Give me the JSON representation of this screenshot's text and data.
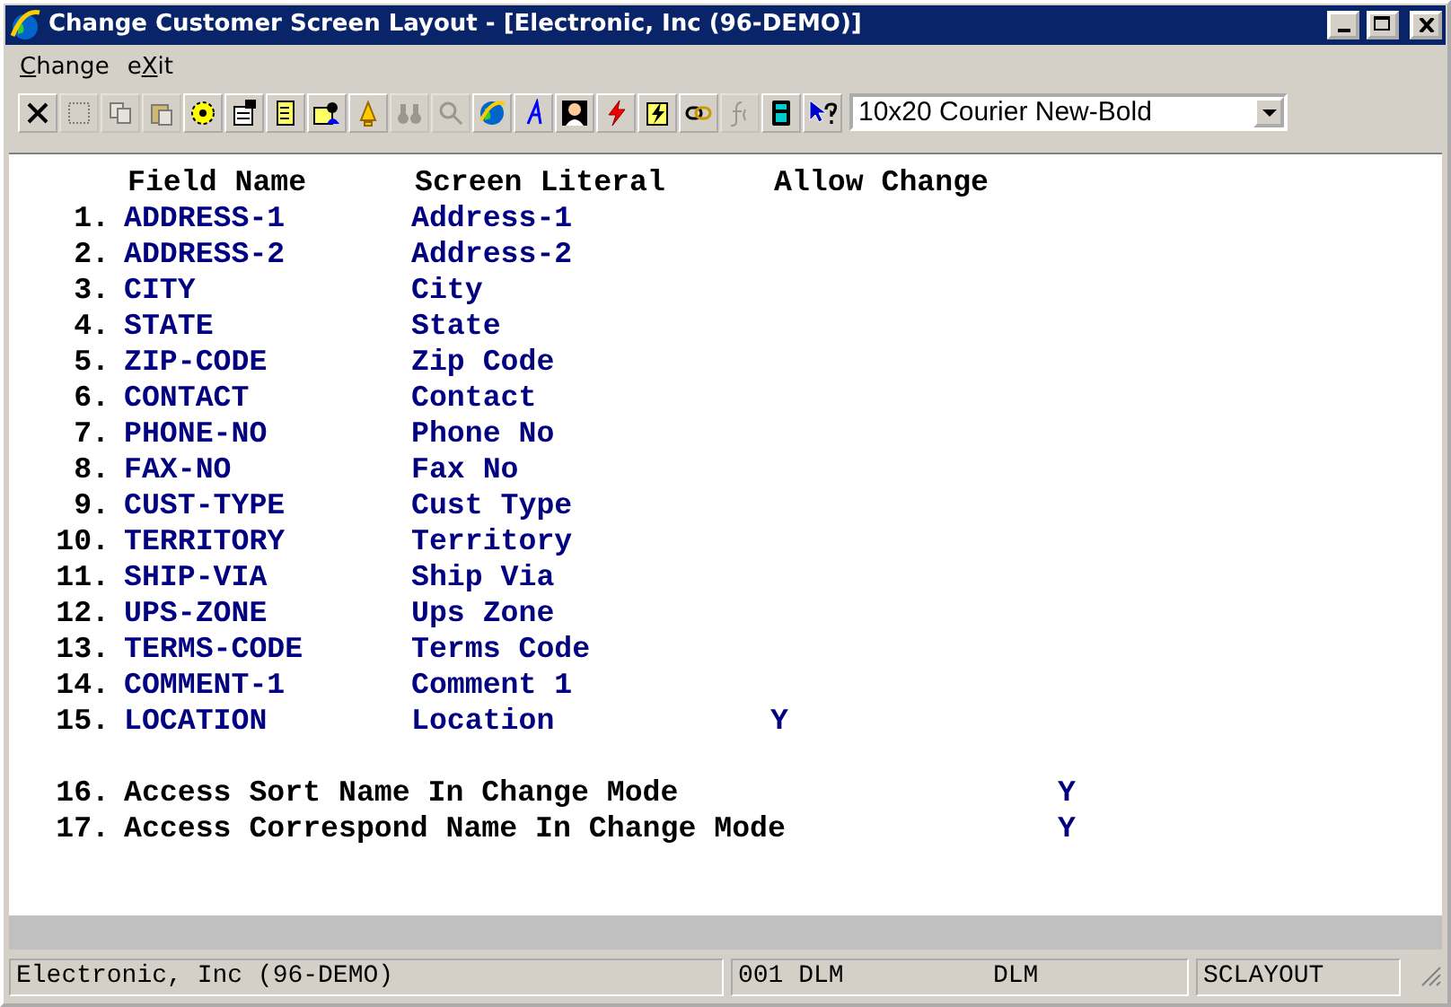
{
  "window": {
    "title": "Change Customer Screen Layout - [Electronic, Inc (96-DEMO)]"
  },
  "menu": [
    {
      "label": "Change"
    },
    {
      "label": "eXit"
    }
  ],
  "toolbar": [
    {
      "kind": "delete",
      "disabled": false
    },
    {
      "kind": "select",
      "disabled": true
    },
    {
      "kind": "copy",
      "disabled": true
    },
    {
      "kind": "paste",
      "disabled": true
    },
    {
      "kind": "gear",
      "disabled": false
    },
    {
      "kind": "properties",
      "disabled": false
    },
    {
      "kind": "document",
      "disabled": false
    },
    {
      "kind": "person-card",
      "disabled": false
    },
    {
      "kind": "bell",
      "disabled": false
    },
    {
      "kind": "binoculars",
      "disabled": true
    },
    {
      "kind": "magnifier",
      "disabled": true
    },
    {
      "kind": "globe",
      "disabled": false
    },
    {
      "kind": "script",
      "disabled": false
    },
    {
      "kind": "person",
      "disabled": false
    },
    {
      "kind": "lightning",
      "disabled": false
    },
    {
      "kind": "lightning-page",
      "disabled": false
    },
    {
      "kind": "link",
      "disabled": false
    },
    {
      "kind": "function",
      "disabled": true
    },
    {
      "kind": "calculator",
      "disabled": false
    },
    {
      "kind": "help-pointer",
      "disabled": false
    }
  ],
  "font_select": {
    "value": "10x20 Courier New-Bold"
  },
  "table": {
    "columns": [
      "Field Name",
      "Screen Literal",
      "Allow Change"
    ],
    "rows": [
      {
        "number": "1.",
        "field": "ADDRESS-1",
        "literal": "Address-1"
      },
      {
        "number": "2.",
        "field": "ADDRESS-2",
        "literal": "Address-2"
      },
      {
        "number": "3.",
        "field": "CITY",
        "literal": "City"
      },
      {
        "number": "4.",
        "field": "STATE",
        "literal": "State"
      },
      {
        "number": "5.",
        "field": "ZIP-CODE",
        "literal": "Zip Code"
      },
      {
        "number": "6.",
        "field": "CONTACT",
        "literal": "Contact"
      },
      {
        "number": "7.",
        "field": "PHONE-NO",
        "literal": "Phone No"
      },
      {
        "number": "8.",
        "field": "FAX-NO",
        "literal": "Fax No"
      },
      {
        "number": "9.",
        "field": "CUST-TYPE",
        "literal": "Cust Type"
      },
      {
        "number": "10.",
        "field": "TERRITORY",
        "literal": "Territory"
      },
      {
        "number": "11.",
        "field": "SHIP-VIA",
        "literal": "Ship Via"
      },
      {
        "number": "12.",
        "field": "UPS-ZONE",
        "literal": "Ups Zone"
      },
      {
        "number": "13.",
        "field": "TERMS-CODE",
        "literal": "Terms Code"
      },
      {
        "number": "14.",
        "field": "COMMENT-1",
        "literal": "Comment 1"
      },
      {
        "number": "15.",
        "field": "LOCATION",
        "literal": "Location",
        "allow": "Y"
      }
    ]
  },
  "options": [
    {
      "number": "16.",
      "label": "Access Sort Name In Change Mode",
      "value": "Y"
    },
    {
      "number": "17.",
      "label": "Access Correspond Name In Change Mode",
      "value": "Y"
    }
  ],
  "status_bar": [
    "Electronic, Inc (96-DEMO)",
    "001 DLM",
    "DLM",
    "SCLAYOUT"
  ]
}
